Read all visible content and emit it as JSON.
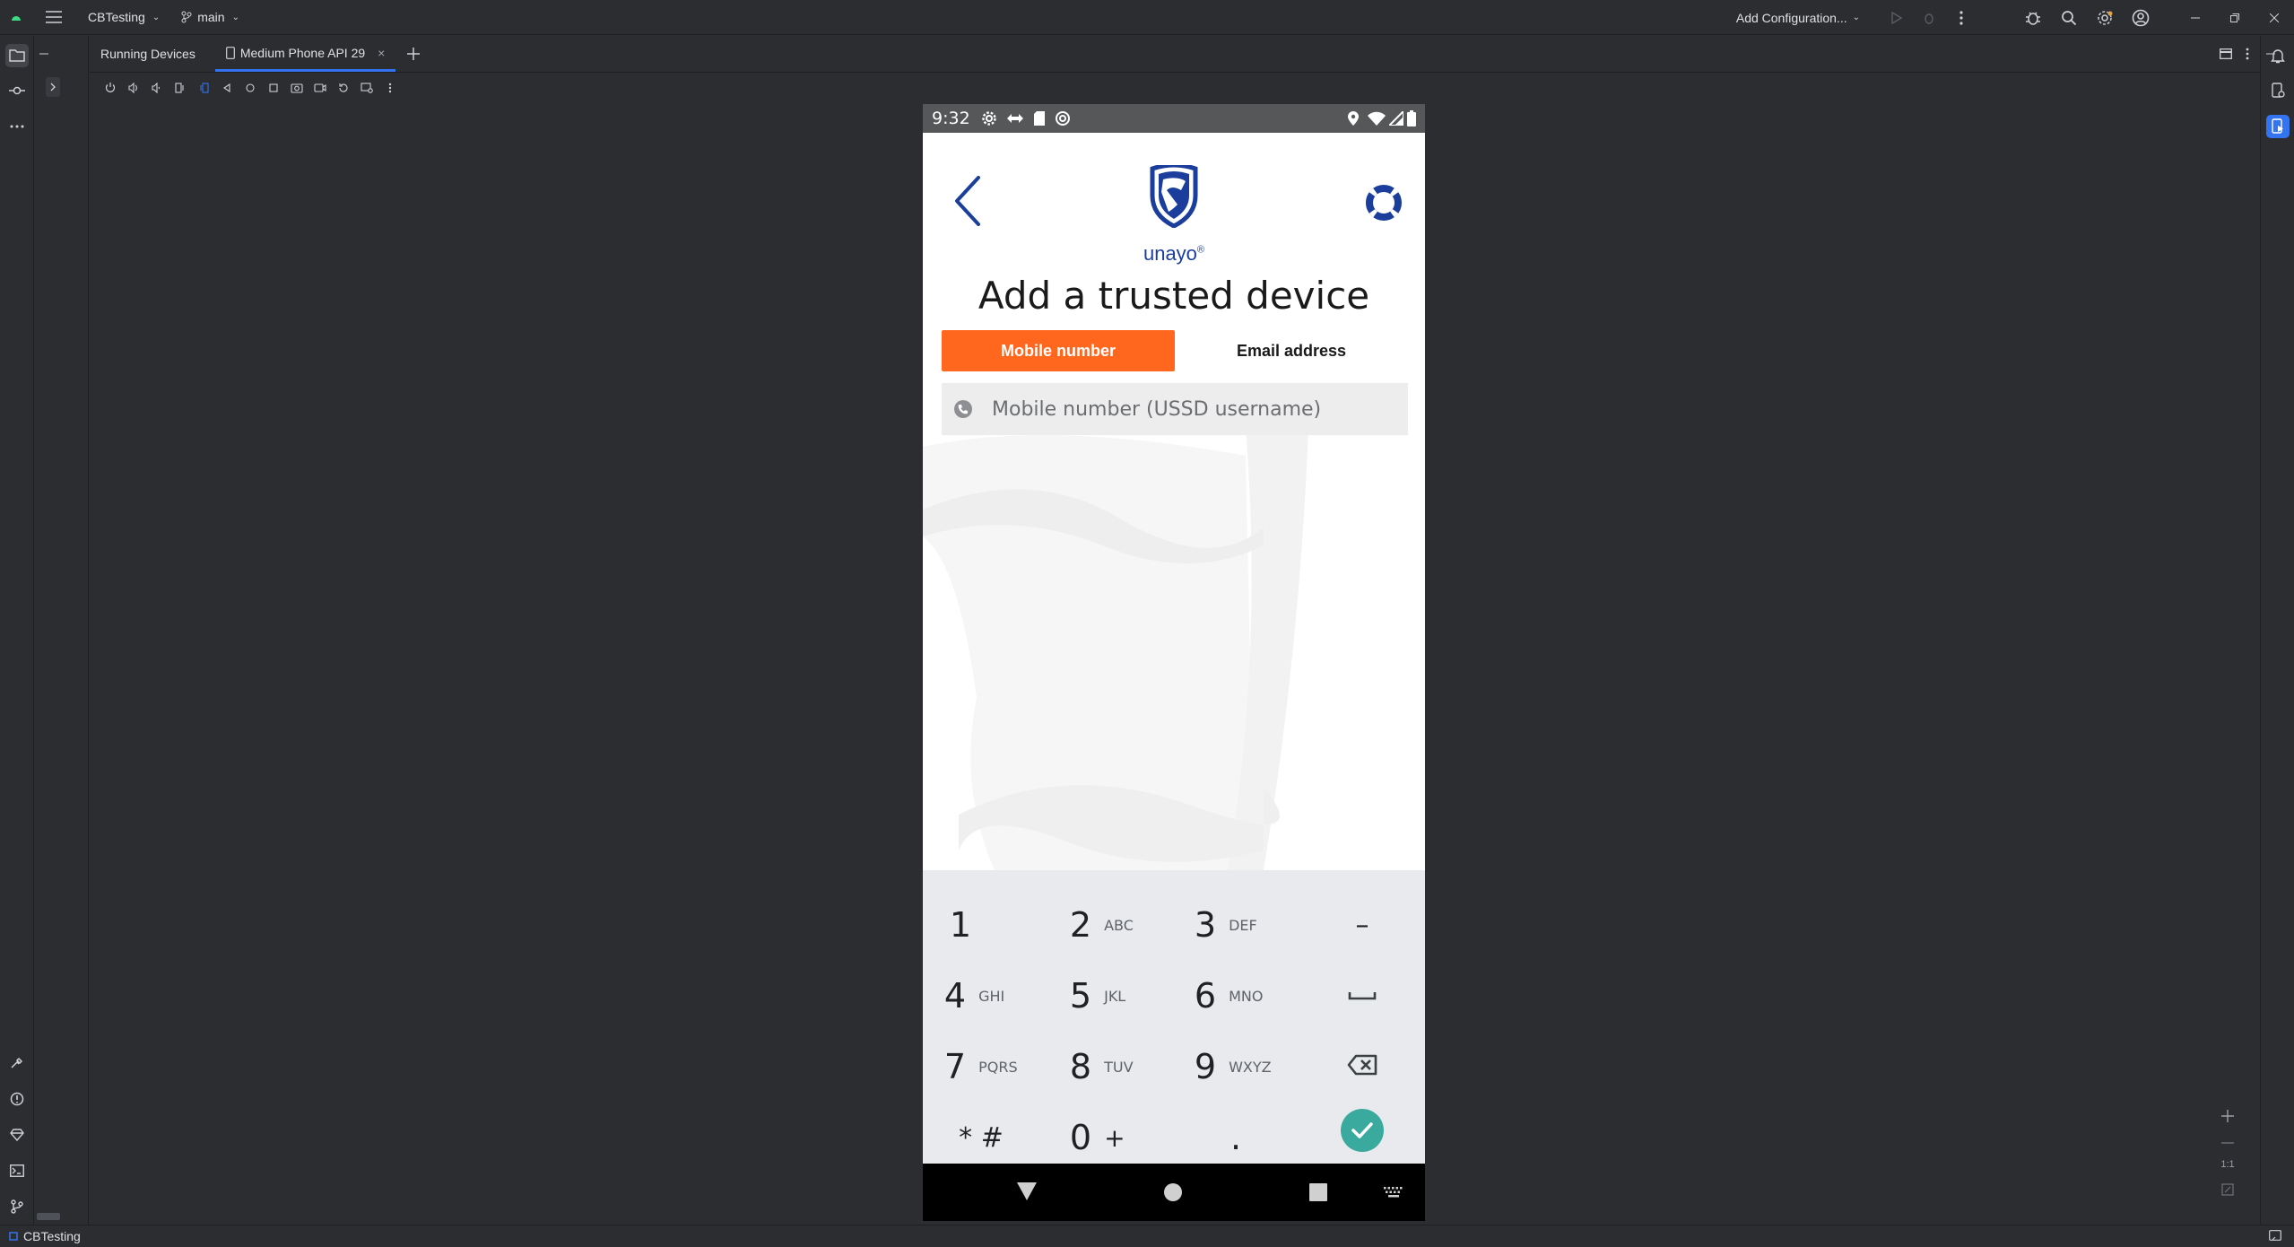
{
  "titlebar": {
    "project": "CBTesting",
    "branch": "main",
    "run_config": "Add Configuration..."
  },
  "tabs": {
    "running_devices": "Running Devices",
    "device_tab": "Medium Phone API 29"
  },
  "phone": {
    "status_time": "9:32",
    "brand": "unayo",
    "brand_mark": "®",
    "heading": "Add a trusted device",
    "segments": [
      "Mobile number",
      "Email address"
    ],
    "active_segment": "Mobile number",
    "input_placeholder": "Mobile number (USSD username)",
    "input_value": ""
  },
  "keypad": {
    "rows": [
      [
        {
          "num": "1",
          "sub": ""
        },
        {
          "num": "2",
          "sub": "ABC"
        },
        {
          "num": "3",
          "sub": "DEF"
        },
        {
          "num": "–",
          "sub": ""
        }
      ],
      [
        {
          "num": "4",
          "sub": "GHI"
        },
        {
          "num": "5",
          "sub": "JKL"
        },
        {
          "num": "6",
          "sub": "MNO"
        },
        {
          "num": "␣",
          "sub": ""
        }
      ],
      [
        {
          "num": "7",
          "sub": "PQRS"
        },
        {
          "num": "8",
          "sub": "TUV"
        },
        {
          "num": "9",
          "sub": "WXYZ"
        },
        {
          "num": "⌫",
          "sub": ""
        }
      ],
      [
        {
          "num": "* #",
          "sub": ""
        },
        {
          "num": "0",
          "sub": "+"
        },
        {
          "num": ".",
          "sub": ""
        },
        {
          "num": "✓",
          "sub": ""
        }
      ]
    ]
  },
  "zoom": {
    "one_to_one": "1:1"
  },
  "bottombar": {
    "project": "CBTesting"
  },
  "colors": {
    "accent_orange": "#ff671f",
    "brand_blue": "#1b3e9c",
    "ide_accent": "#3574f0",
    "confirm_teal": "#3aa99e"
  }
}
